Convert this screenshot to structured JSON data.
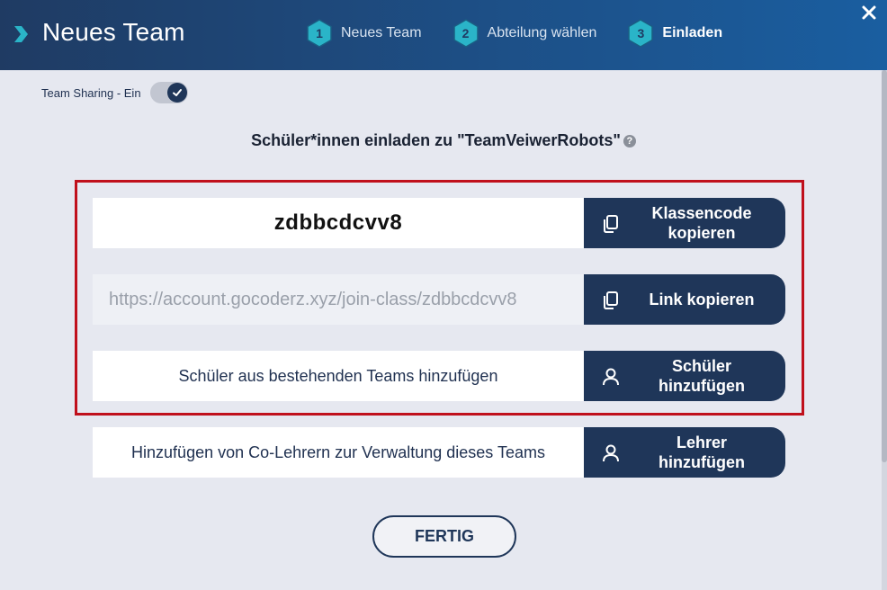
{
  "header": {
    "title": "Neues Team",
    "steps": [
      {
        "number": "1",
        "label": "Neues Team",
        "active": false
      },
      {
        "number": "2",
        "label": "Abteilung wählen",
        "active": false
      },
      {
        "number": "3",
        "label": "Einladen",
        "active": true
      }
    ],
    "close_icon": "close-icon"
  },
  "sharing": {
    "label": "Team Sharing - Ein",
    "enabled": true
  },
  "heading": {
    "text": "Schüler*innen einladen zu \"TeamVeiwerRobots\"",
    "help_glyph": "?"
  },
  "rows": {
    "code": {
      "value": "zdbbcdcvv8",
      "button_label": "Klassencode\nkopieren",
      "icon": "copy-icon"
    },
    "link": {
      "value": "https://account.gocoderz.xyz/join-class/zdbbcdcvv8",
      "button_label": "Link kopieren",
      "icon": "copy-icon"
    },
    "students": {
      "text": "Schüler aus bestehenden Teams hinzufügen",
      "button_label": "Schüler\nhinzufügen",
      "icon": "user-icon"
    },
    "teachers": {
      "text": "Hinzufügen von Co-Lehrern zur Verwaltung dieses Teams",
      "button_label": "Lehrer\nhinzufügen",
      "icon": "user-icon"
    }
  },
  "done_button": "FERTIG",
  "colors": {
    "navy": "#1f3659",
    "teal": "#2ab4c8",
    "highlight": "#c0101c",
    "background": "#e6e8f0"
  }
}
